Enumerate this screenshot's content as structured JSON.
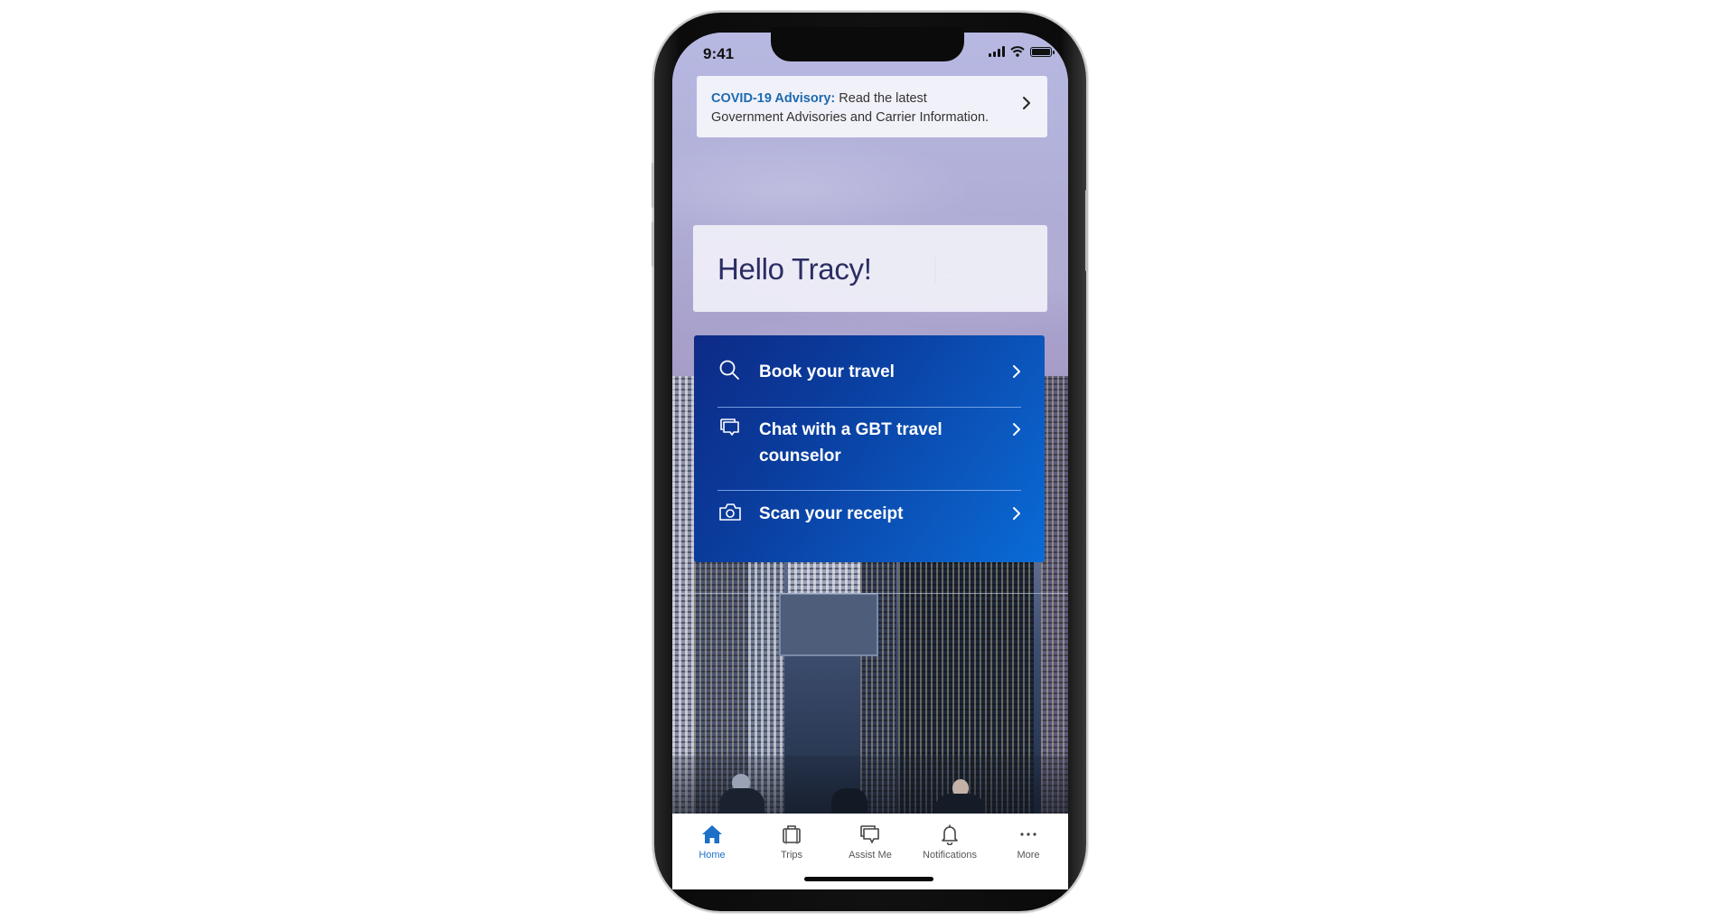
{
  "status_bar": {
    "time": "9:41",
    "icons": [
      "cellular-signal-icon",
      "wifi-icon",
      "battery-icon"
    ]
  },
  "advisory": {
    "title": "COVID-19 Advisory:",
    "text_line1": " Read the latest",
    "text_line2": "Government Advisories and Carrier Information.",
    "icon": "chevron-right-icon"
  },
  "greeting": {
    "text": "Hello Tracy!"
  },
  "actions": [
    {
      "icon": "search-icon",
      "label": "Book your travel"
    },
    {
      "icon": "chat-icon",
      "label": "Chat with a GBT travel counselor"
    },
    {
      "icon": "camera-icon",
      "label": "Scan your receipt"
    }
  ],
  "tabbar": {
    "active": "Home",
    "items": [
      {
        "icon": "home-icon",
        "label": "Home"
      },
      {
        "icon": "suitcase-icon",
        "label": "Trips"
      },
      {
        "icon": "chat-icon",
        "label": "Assist Me"
      },
      {
        "icon": "bell-icon",
        "label": "Notifications"
      },
      {
        "icon": "more-dots-icon",
        "label": "More"
      }
    ]
  },
  "colors": {
    "accent_blue": "#1e6fc8",
    "advisory_title": "#1d6ab0",
    "greeting_text": "#2b2d63",
    "card_gradient_start": "#0e2a86",
    "card_gradient_end": "#0a6bd6"
  }
}
